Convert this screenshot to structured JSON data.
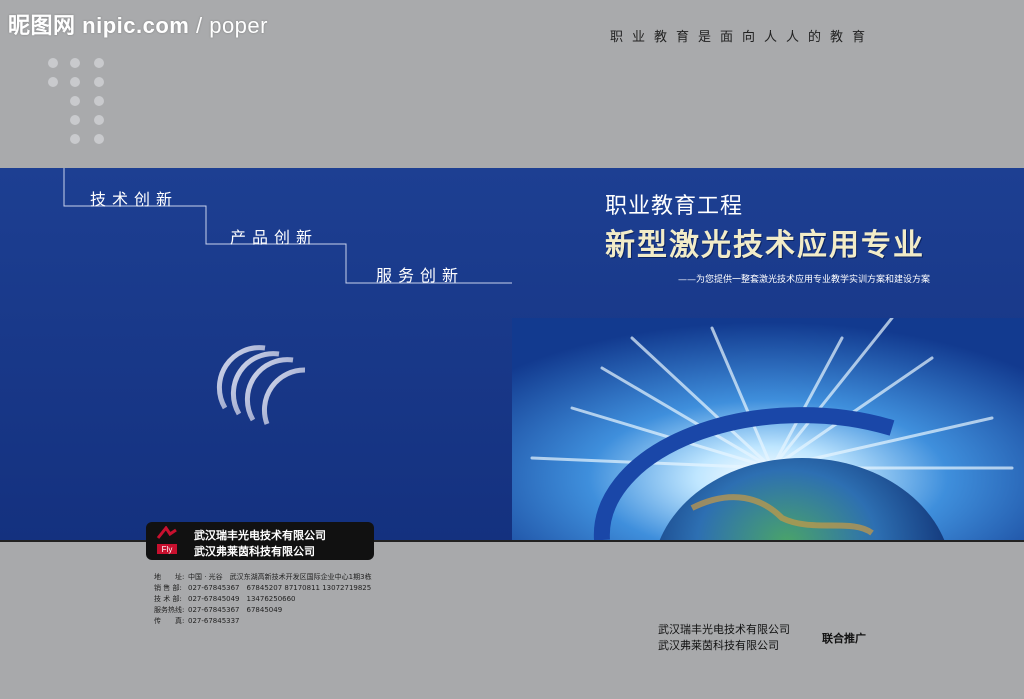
{
  "watermark": {
    "brand": "昵图网",
    "site": "nipic.com",
    "user": "poper"
  },
  "tagline": "职业教育是面向人人的教育",
  "steps": [
    "技术创新",
    "产品创新",
    "服务创新"
  ],
  "title": {
    "small": "职业教育工程",
    "big": "新型激光技术应用专业",
    "subtitle": "——为您提供一整套激光技术应用专业教学实训方案和建设方案"
  },
  "companies": [
    "武汉瑞丰光电技术有限公司",
    "武汉弗莱茵科技有限公司"
  ],
  "contact": [
    {
      "label": "地　　址:",
      "value": "中国 · 光谷　武汉东湖高新技术开发区国际企业中心1期3栋"
    },
    {
      "label": "销 售 部:",
      "value": "027-67845367　67845207  87170811  13072719825"
    },
    {
      "label": "技 术 部:",
      "value": "027-67845049　13476250660"
    },
    {
      "label": "服务热线:",
      "value": "027-67845367　67845049"
    },
    {
      "label": "传　　真:",
      "value": "027-67845337"
    }
  ],
  "promoters": {
    "companies": [
      "武汉瑞丰光电技术有限公司",
      "武汉弗莱茵科技有限公司"
    ],
    "tag": "联合推广"
  },
  "colors": {
    "blue_band": "#1a3a8c",
    "gray": "#a9aaac",
    "gold_title": "#f2ecc8"
  }
}
